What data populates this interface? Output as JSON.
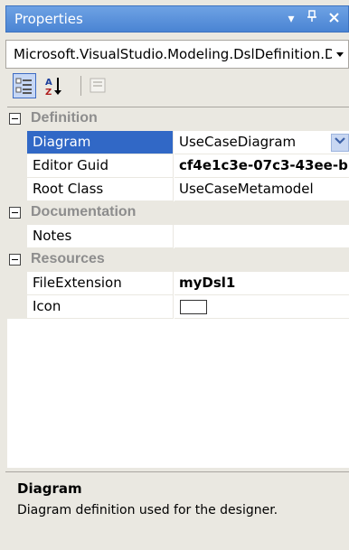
{
  "window": {
    "title": "Properties",
    "buttons": [
      "▾",
      "ᵖ",
      "✕"
    ]
  },
  "object_selector": {
    "value": "Microsoft.VisualStudio.Modeling.DslDefinition.D"
  },
  "toolbar": {
    "icons": [
      "categorized-icon",
      "alphabetical-icon",
      "property-pages-icon"
    ],
    "az_label": "A↓Z"
  },
  "grid": {
    "categories": [
      {
        "label": "Definition",
        "properties": [
          {
            "name": "Diagram",
            "value": "UseCaseDiagram",
            "selected": true,
            "dropdown": true
          },
          {
            "name": "Editor Guid",
            "value": "cf4e1c3e-07c3-43ee-b",
            "bold": true
          },
          {
            "name": "Root Class",
            "value": "UseCaseMetamodel"
          }
        ]
      },
      {
        "label": "Documentation",
        "properties": [
          {
            "name": "Notes",
            "value": ""
          }
        ]
      },
      {
        "label": "Resources",
        "properties": [
          {
            "name": "FileExtension",
            "value": "myDsl1",
            "bold": true
          },
          {
            "name": "Icon",
            "value": ""
          }
        ]
      }
    ]
  },
  "description": {
    "title": "Diagram",
    "text": "Diagram definition used for the designer."
  },
  "colors": {
    "titlebar": "#4a84d3",
    "selection": "#3168c6",
    "panel": "#eae8e1"
  }
}
